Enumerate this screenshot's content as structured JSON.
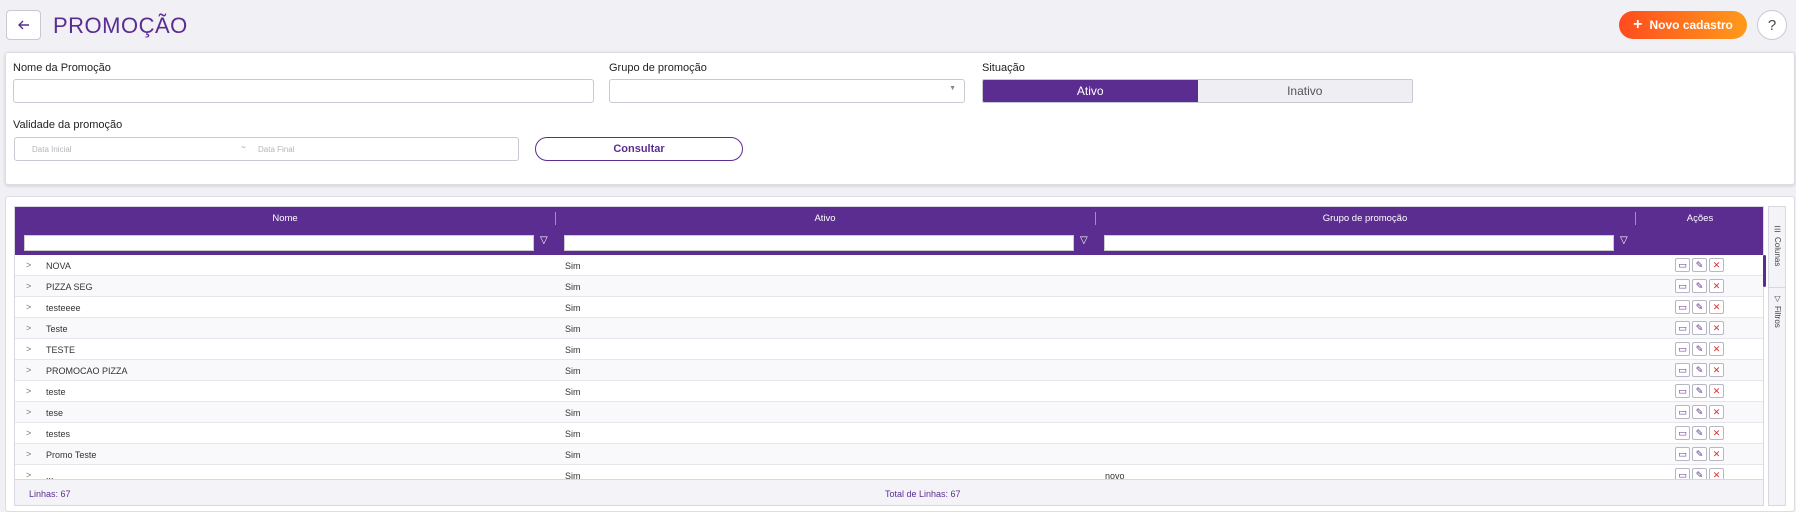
{
  "header": {
    "title": "PROMOÇÃO",
    "new_button_label": "Novo cadastro",
    "help_label": "?"
  },
  "filters": {
    "nome_label": "Nome da Promoção",
    "nome_value": "",
    "grupo_label": "Grupo de promoção",
    "grupo_value": "",
    "situacao_label": "Situação",
    "situacao_options": [
      "Ativo",
      "Inativo"
    ],
    "situacao_selected": "Ativo",
    "validade_label": "Validade da promoção",
    "data_inicial_placeholder": "Data Inicial",
    "data_separator": "~",
    "data_final_placeholder": "Data Final",
    "consultar_label": "Consultar"
  },
  "grid": {
    "columns": [
      "Nome",
      "Ativo",
      "Grupo de promoção",
      "Ações"
    ],
    "rows": [
      {
        "nome": "NOVA",
        "ativo": "Sim",
        "grupo": ""
      },
      {
        "nome": "PIZZA SEG",
        "ativo": "Sim",
        "grupo": ""
      },
      {
        "nome": "testeeee",
        "ativo": "Sim",
        "grupo": ""
      },
      {
        "nome": "Teste",
        "ativo": "Sim",
        "grupo": ""
      },
      {
        "nome": "TESTE",
        "ativo": "Sim",
        "grupo": ""
      },
      {
        "nome": "PROMOCAO PIZZA",
        "ativo": "Sim",
        "grupo": ""
      },
      {
        "nome": "teste",
        "ativo": "Sim",
        "grupo": ""
      },
      {
        "nome": "tese",
        "ativo": "Sim",
        "grupo": ""
      },
      {
        "nome": "testes",
        "ativo": "Sim",
        "grupo": ""
      },
      {
        "nome": "Promo Teste",
        "ativo": "Sim",
        "grupo": ""
      },
      {
        "nome": "...",
        "ativo": "Sim",
        "grupo": "novo"
      }
    ],
    "footer_rows_label": "Linhas: 67",
    "footer_total_label": "Total de Linhas: 67",
    "side_tabs": [
      "Colunas",
      "Filtros"
    ]
  },
  "colors": {
    "primary": "#5c2d91",
    "accent_start": "#ff4b1f",
    "accent_end": "#ff9a1a",
    "delete": "#d32f2f"
  }
}
